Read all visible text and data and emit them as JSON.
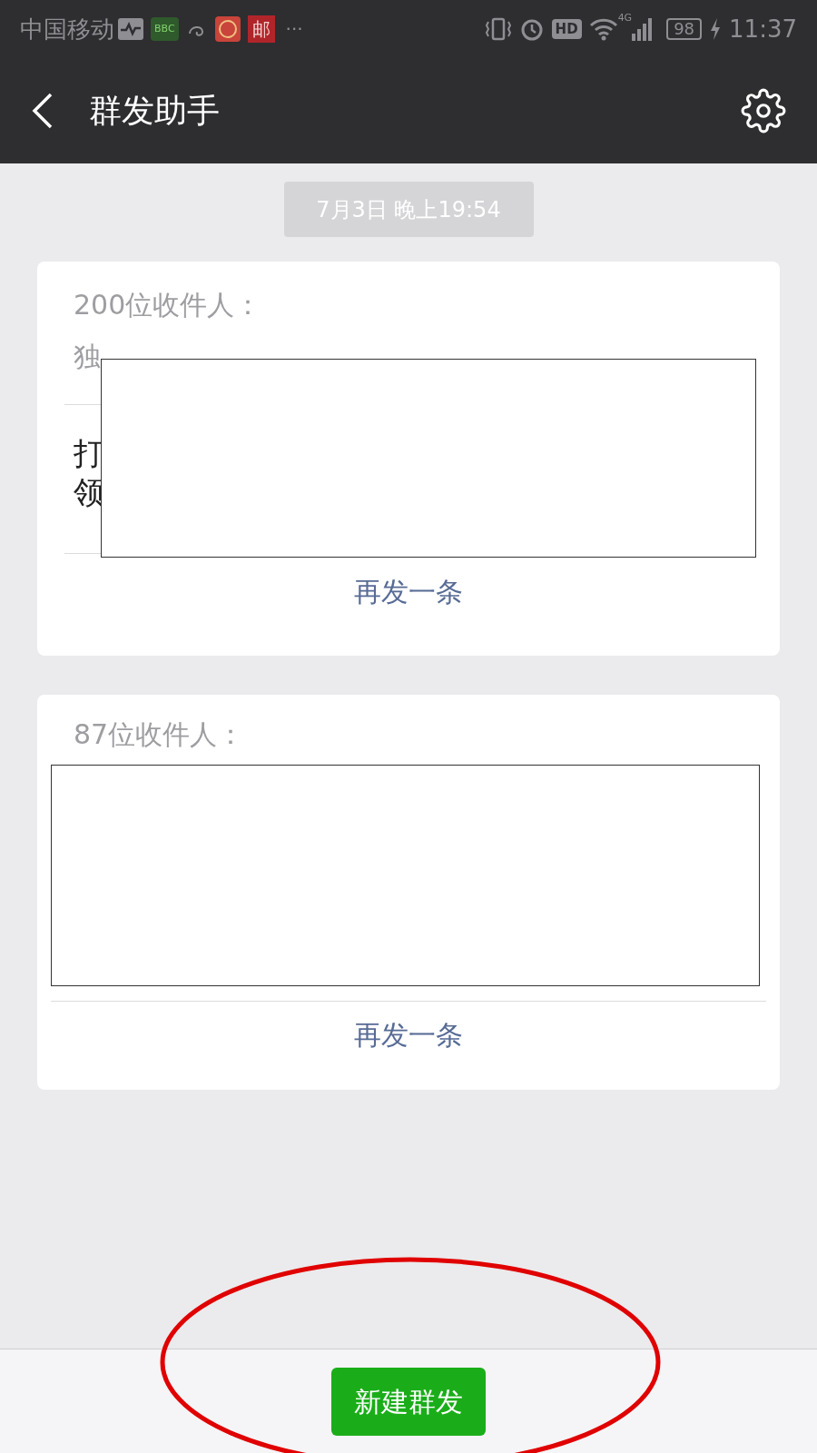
{
  "status_bar": {
    "carrier": "中国移动",
    "badge_text": "BBC",
    "mail_app_text": "邮",
    "more": "···",
    "hd": "HD",
    "network": "4G",
    "battery": "98",
    "time": "11:37"
  },
  "header": {
    "title": "群发助手"
  },
  "date_label": "7月3日 晚上19:54",
  "messages": [
    {
      "recipients_label": "200位收件人：",
      "recipients_preview": "独",
      "message_lines": [
        "打",
        "领"
      ],
      "redacted": true,
      "resend": "再发一条"
    },
    {
      "recipients_label": "87位收件人：",
      "redacted": true,
      "resend": "再发一条"
    }
  ],
  "bottom_bar": {
    "button": "新建群发",
    "circled": true
  }
}
